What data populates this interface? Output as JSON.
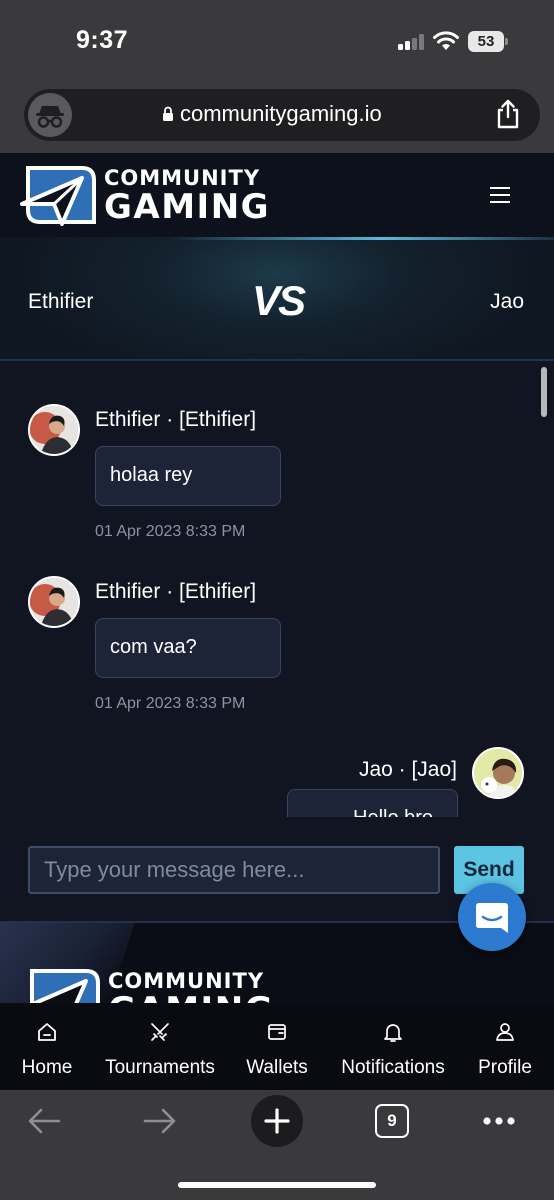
{
  "status_bar": {
    "time": "9:37",
    "battery": "53"
  },
  "browser": {
    "url": "communitygaming.io",
    "open_tabs": "9"
  },
  "site": {
    "logo_line1": "COMMUNITY",
    "logo_line2": "GAMING"
  },
  "match": {
    "player_left": "Ethifier",
    "vs_label": "VS",
    "player_right": "Jao"
  },
  "messages": [
    {
      "sender": "Ethifier · [Ethifier]",
      "text": "holaa rey",
      "time": "01 Apr 2023 8:33 PM"
    },
    {
      "sender": "Ethifier · [Ethifier]",
      "text": "com vaa?",
      "time": "01 Apr 2023 8:33 PM"
    },
    {
      "sender": "Jao · [Jao]",
      "text": "Hello bro"
    }
  ],
  "composer": {
    "placeholder": "Type your message here...",
    "send_label": "Send"
  },
  "nav": {
    "items": [
      {
        "label": "Home",
        "icon": "home-icon"
      },
      {
        "label": "Tournaments",
        "icon": "swords-icon"
      },
      {
        "label": "Wallets",
        "icon": "wallet-icon"
      },
      {
        "label": "Notifications",
        "icon": "bell-icon"
      },
      {
        "label": "Profile",
        "icon": "user-icon"
      }
    ]
  },
  "colors": {
    "page_bg": "#101521",
    "bubble_bg": "#1e2437",
    "send_button": "#5cc5e4",
    "chat_fab": "#2d7bd1",
    "timestamp": "#8794a8"
  }
}
